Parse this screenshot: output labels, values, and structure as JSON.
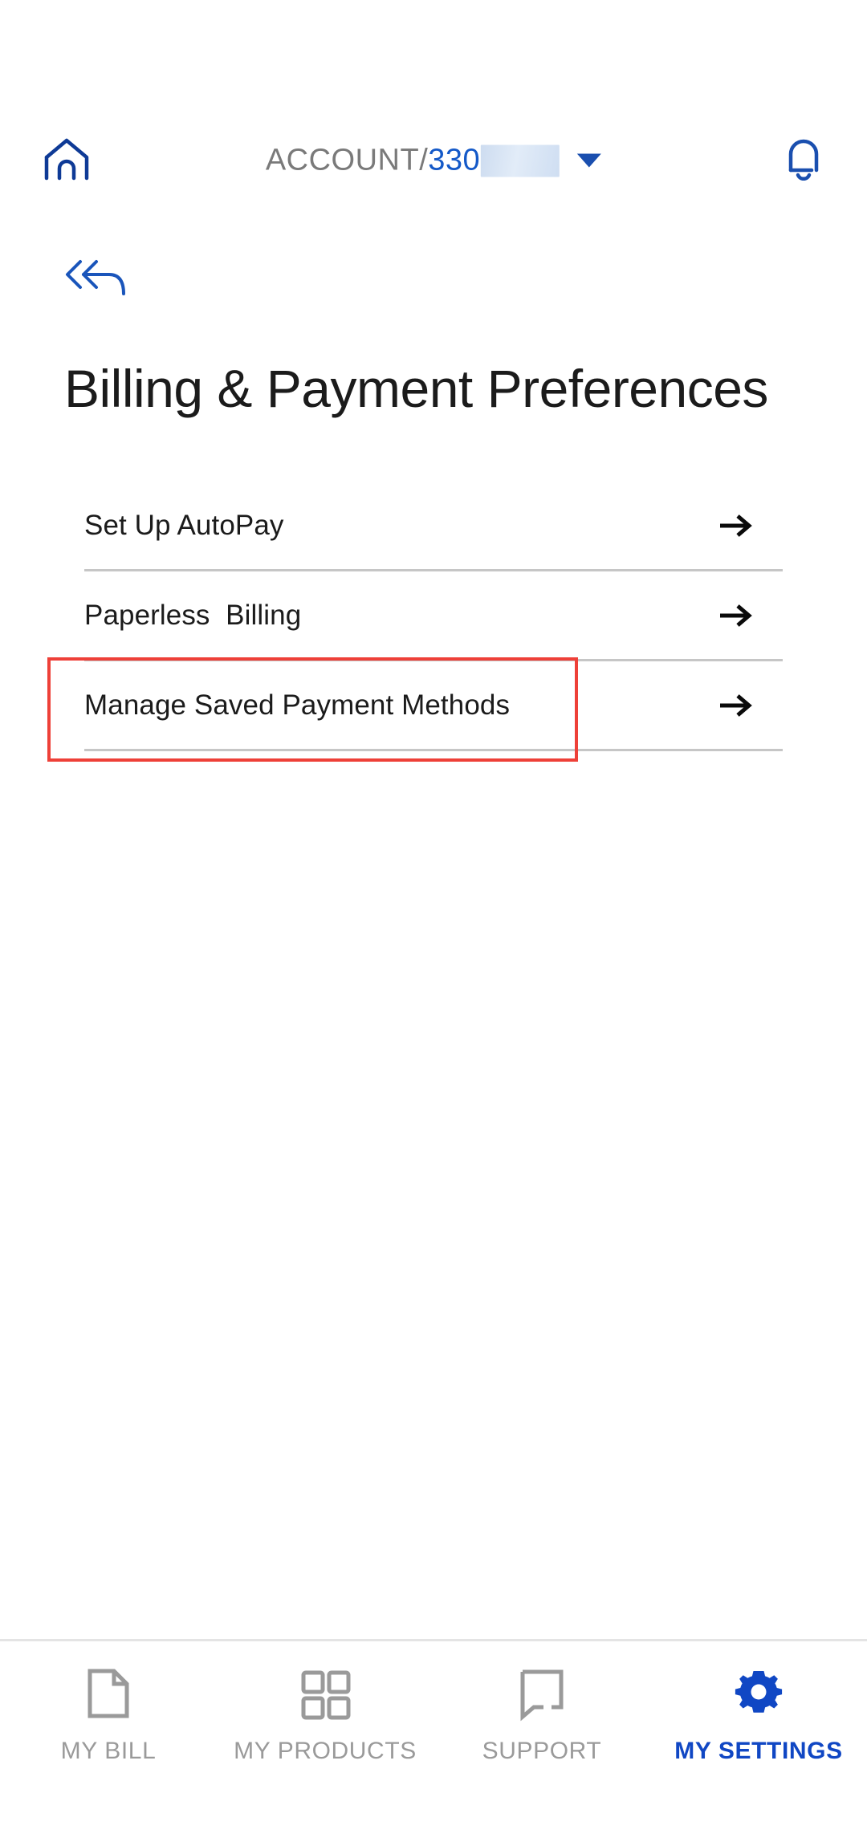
{
  "colors": {
    "stripe_navy": "#0c2461",
    "stripe_blue": "#0b53cd",
    "stripe_green": "#4cd699",
    "accent_blue": "#1459c8",
    "home_icon_navy": "#0e3a96",
    "bell_icon_blue": "#1a4faf",
    "active_tab_blue": "#1047c4",
    "inactive_tab_gray": "#9a9a9a",
    "divider_gray": "#c6c6c6",
    "annotation_red": "#ee4038",
    "title_black": "#1b1b1b",
    "account_label_gray": "#7a7a7a",
    "redaction_blue": "#cddcf0"
  },
  "header": {
    "home_icon": "home-icon",
    "account_prefix": "ACCOUNT/",
    "account_number_visible": "330",
    "account_number_redacted": true,
    "dropdown_icon": "chevron-down-icon",
    "notification_icon": "bell-icon"
  },
  "back_nav": {
    "icon": "back-arrow-icon",
    "label": ""
  },
  "page": {
    "title": "Billing & Payment Preferences"
  },
  "preferences": {
    "items": [
      {
        "label": "Set Up AutoPay",
        "arrow_icon": "arrow-right-icon",
        "highlighted": false
      },
      {
        "label": "Paperless  Billing",
        "arrow_icon": "arrow-right-icon",
        "highlighted": false
      },
      {
        "label": "Manage Saved Payment Methods",
        "arrow_icon": "arrow-right-icon",
        "highlighted": true
      }
    ]
  },
  "annotation": {
    "target": "Manage Saved Payment Methods",
    "color": "#ee4038"
  },
  "tab_bar": {
    "tabs": [
      {
        "label": "MY BILL",
        "icon": "document-icon",
        "active": false
      },
      {
        "label": "MY PRODUCTS",
        "icon": "grid-squares-icon",
        "active": false
      },
      {
        "label": "SUPPORT",
        "icon": "speech-bubble-icon",
        "active": false
      },
      {
        "label": "MY SETTINGS",
        "icon": "gear-icon",
        "active": true
      }
    ]
  }
}
